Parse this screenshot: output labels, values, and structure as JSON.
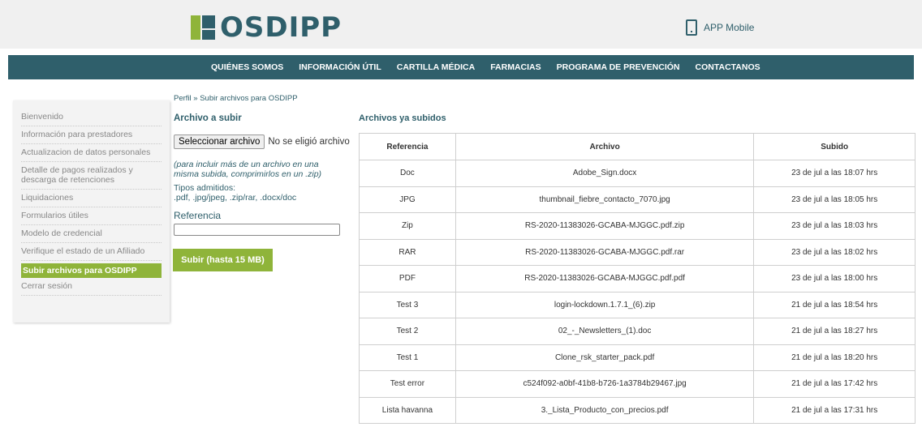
{
  "header": {
    "logo_text": "OSDIPP",
    "app_mobile": "APP Mobile"
  },
  "nav": [
    {
      "label": "QUIÉNES SOMOS"
    },
    {
      "label": "INFORMACIÓN ÚTIL"
    },
    {
      "label": "CARTILLA MÉDICA"
    },
    {
      "label": "FARMACIAS"
    },
    {
      "label": "PROGRAMA DE PREVENCIÓN"
    },
    {
      "label": "CONTACTANOS"
    }
  ],
  "sidebar": {
    "items": [
      {
        "label": "Bienvenido"
      },
      {
        "label": "Información para prestadores"
      },
      {
        "label": "Actualizacion de datos personales"
      },
      {
        "label": "Detalle de pagos realizados y descarga de retenciones"
      },
      {
        "label": "Liquidaciones"
      },
      {
        "label": "Formularios útiles"
      },
      {
        "label": "Modelo de credencial"
      },
      {
        "label": "Verifique el estado de un Afiliado"
      },
      {
        "label": "Subir archivos para OSDIPP",
        "active": true
      },
      {
        "label": "Cerrar sesión"
      }
    ]
  },
  "upload": {
    "breadcrumb": "Perfil » Subir archivos para OSDIPP",
    "title": "Archivo a subir",
    "file_button": "Seleccionar archivo",
    "no_file": "No se eligió archivo",
    "hint": "(para incluir más de un archivo en una misma subida, comprimirlos en un .zip)",
    "types_label": "Tipos admitidos:",
    "types": ".pdf, .jpg/jpeg, .zip/rar, .docx/doc",
    "reference_label": "Referencia",
    "reference_value": "",
    "submit_label": "Subir (hasta 15 MB)"
  },
  "files": {
    "title": "Archivos ya subidos",
    "headers": [
      "Referencia",
      "Archivo",
      "Subido"
    ],
    "rows": [
      [
        "Doc",
        "Adobe_Sign.docx",
        "23 de jul a las 18:07 hrs"
      ],
      [
        "JPG",
        "thumbnail_fiebre_contacto_7070.jpg",
        "23 de jul a las 18:05 hrs"
      ],
      [
        "Zip",
        "RS-2020-11383026-GCABA-MJGGC.pdf.zip",
        "23 de jul a las 18:03 hrs"
      ],
      [
        "RAR",
        "RS-2020-11383026-GCABA-MJGGC.pdf.rar",
        "23 de jul a las 18:02 hrs"
      ],
      [
        "PDF",
        "RS-2020-11383026-GCABA-MJGGC.pdf.pdf",
        "23 de jul a las 18:00 hrs"
      ],
      [
        "Test 3",
        "login-lockdown.1.7.1_(6).zip",
        "21 de jul a las 18:54 hrs"
      ],
      [
        "Test 2",
        "02_-_Newsletters_(1).doc",
        "21 de jul a las 18:27 hrs"
      ],
      [
        "Test 1",
        "Clone_rsk_starter_pack.pdf",
        "21 de jul a las 18:20 hrs"
      ],
      [
        "Test error",
        "c524f092-a0bf-41b8-b726-1a3784b29467.jpg",
        "21 de jul a las 17:42 hrs"
      ],
      [
        "Lista havanna",
        "3._Lista_Producto_con_precios.pdf",
        "21 de jul a las 17:31 hrs"
      ]
    ]
  },
  "colors": {
    "brand_teal": "#2f5f6b",
    "brand_green": "#8fb43a"
  }
}
